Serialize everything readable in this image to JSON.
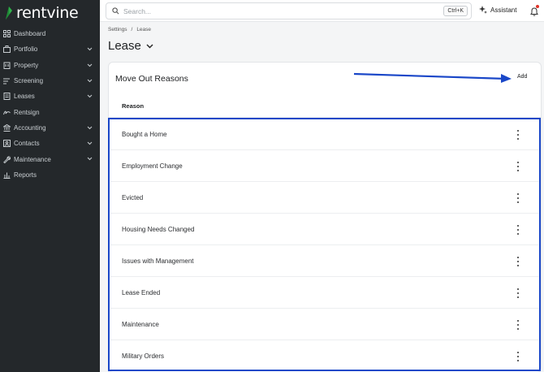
{
  "brand": {
    "name": "rentvine",
    "color": "#2fb14a"
  },
  "sidebar": {
    "items": [
      {
        "label": "Dashboard",
        "icon": "dashboard-icon",
        "chevron": false
      },
      {
        "label": "Portfolio",
        "icon": "briefcase-icon",
        "chevron": true
      },
      {
        "label": "Property",
        "icon": "building-icon",
        "chevron": true
      },
      {
        "label": "Screening",
        "icon": "screening-icon",
        "chevron": true
      },
      {
        "label": "Leases",
        "icon": "document-icon",
        "chevron": true
      },
      {
        "label": "Rentsign",
        "icon": "signature-icon",
        "chevron": false
      },
      {
        "label": "Accounting",
        "icon": "bank-icon",
        "chevron": true
      },
      {
        "label": "Contacts",
        "icon": "contacts-icon",
        "chevron": true
      },
      {
        "label": "Maintenance",
        "icon": "wrench-icon",
        "chevron": true
      },
      {
        "label": "Reports",
        "icon": "chart-icon",
        "chevron": false
      }
    ]
  },
  "topbar": {
    "search_placeholder": "Search...",
    "shortcut": "Ctrl+K",
    "assistant_label": "Assistant"
  },
  "breadcrumb": {
    "items": [
      "Settings",
      "Lease"
    ],
    "separator": "/"
  },
  "page": {
    "title": "Lease"
  },
  "card": {
    "title": "Move Out Reasons",
    "add_label": "Add",
    "column_header": "Reason",
    "rows": [
      "Bought a Home",
      "Employment Change",
      "Evicted",
      "Housing Needs Changed",
      "Issues with Management",
      "Lease Ended",
      "Maintenance",
      "Military Orders"
    ]
  },
  "colors": {
    "sidebar_bg": "#24282b",
    "annotation_blue": "#1a47c8"
  }
}
